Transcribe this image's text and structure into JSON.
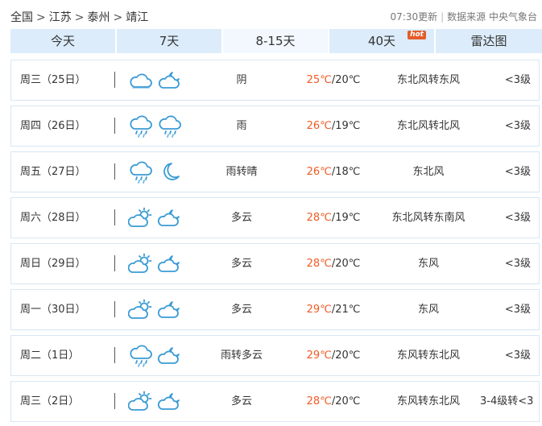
{
  "breadcrumb": {
    "items": [
      "全国",
      "江苏",
      "泰州",
      "靖江"
    ],
    "separator": ">"
  },
  "meta": {
    "updated": "07:30更新",
    "source": "数据来源 中央气象台"
  },
  "tabs": [
    {
      "label": "今天",
      "active": false
    },
    {
      "label": "7天",
      "active": false
    },
    {
      "label": "8-15天",
      "active": true
    },
    {
      "label": "40天",
      "active": false,
      "badge": "hot"
    },
    {
      "label": "雷达图",
      "active": false
    }
  ],
  "forecast": [
    {
      "date": "周三（25日）",
      "icon_day": "cloudy-icon",
      "icon_night": "cloudy-night-icon",
      "desc": "阴",
      "high": "25℃",
      "low": "/20℃",
      "wind": "东北风转东风",
      "level": "<3级"
    },
    {
      "date": "周四（26日）",
      "icon_day": "rain-icon",
      "icon_night": "rain-icon",
      "desc": "雨",
      "high": "26℃",
      "low": "/19℃",
      "wind": "东北风转北风",
      "level": "<3级"
    },
    {
      "date": "周五（27日）",
      "icon_day": "rain-icon",
      "icon_night": "moon-icon",
      "desc": "雨转晴",
      "high": "26℃",
      "low": "/18℃",
      "wind": "东北风",
      "level": "<3级"
    },
    {
      "date": "周六（28日）",
      "icon_day": "partly-cloudy-day-icon",
      "icon_night": "partly-cloudy-night-icon",
      "desc": "多云",
      "high": "28℃",
      "low": "/19℃",
      "wind": "东北风转东南风",
      "level": "<3级"
    },
    {
      "date": "周日（29日）",
      "icon_day": "partly-cloudy-day-icon",
      "icon_night": "partly-cloudy-night-icon",
      "desc": "多云",
      "high": "28℃",
      "low": "/20℃",
      "wind": "东风",
      "level": "<3级"
    },
    {
      "date": "周一（30日）",
      "icon_day": "partly-cloudy-day-icon",
      "icon_night": "partly-cloudy-night-icon",
      "desc": "多云",
      "high": "29℃",
      "low": "/21℃",
      "wind": "东风",
      "level": "<3级"
    },
    {
      "date": "周二（1日）",
      "icon_day": "rain-icon",
      "icon_night": "partly-cloudy-night-icon",
      "desc": "雨转多云",
      "high": "29℃",
      "low": "/20℃",
      "wind": "东风转东北风",
      "level": "<3级"
    },
    {
      "date": "周三（2日）",
      "icon_day": "partly-cloudy-day-icon",
      "icon_night": "partly-cloudy-night-icon",
      "desc": "多云",
      "high": "28℃",
      "low": "/20℃",
      "wind": "东风转东北风",
      "level": "3-4级转<3"
    }
  ],
  "colors": {
    "accent_temp": "#f05a24",
    "icon_stroke": "#3a9bd5",
    "tab_bg": "#dcecfb",
    "tab_active_bg": "#f3f8fe"
  }
}
